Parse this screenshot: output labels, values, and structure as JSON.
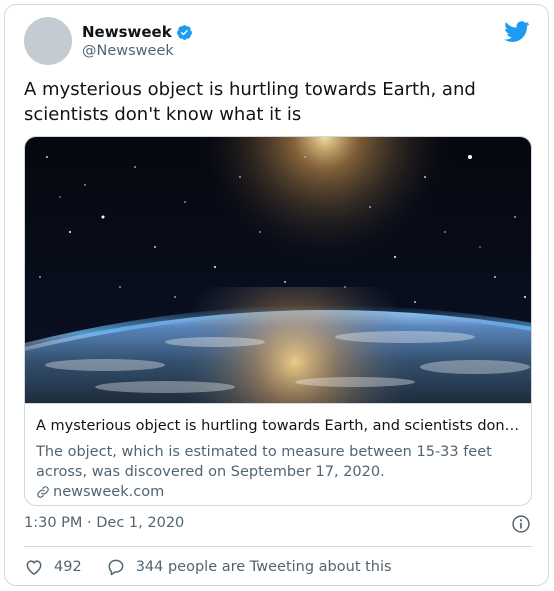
{
  "author": {
    "name": "Newsweek",
    "handle": "@Newsweek",
    "verified": true
  },
  "icons": {
    "verified": "verified-badge-icon",
    "brand": "twitter-bird-icon",
    "link": "link-icon",
    "info": "info-icon",
    "like": "heart-icon",
    "reply": "speech-bubble-icon"
  },
  "colors": {
    "accent": "#1d9bf0",
    "text": "#0f1419",
    "secondary": "#536471",
    "border": "#cfd9de"
  },
  "tweet": {
    "text": "A mysterious object is hurtling towards Earth, and scientists don't know what it is",
    "timestamp": "1:30 PM · Dec 1, 2020"
  },
  "link_card": {
    "title": "A mysterious object is hurtling towards Earth, and scientists don't kn…",
    "description": "The object, which is estimated to measure between 15-33 feet across, was discovered on September 17, 2020.",
    "domain": "newsweek.com"
  },
  "actions": {
    "likes": "492",
    "tweeting": "344 people are Tweeting about this"
  }
}
